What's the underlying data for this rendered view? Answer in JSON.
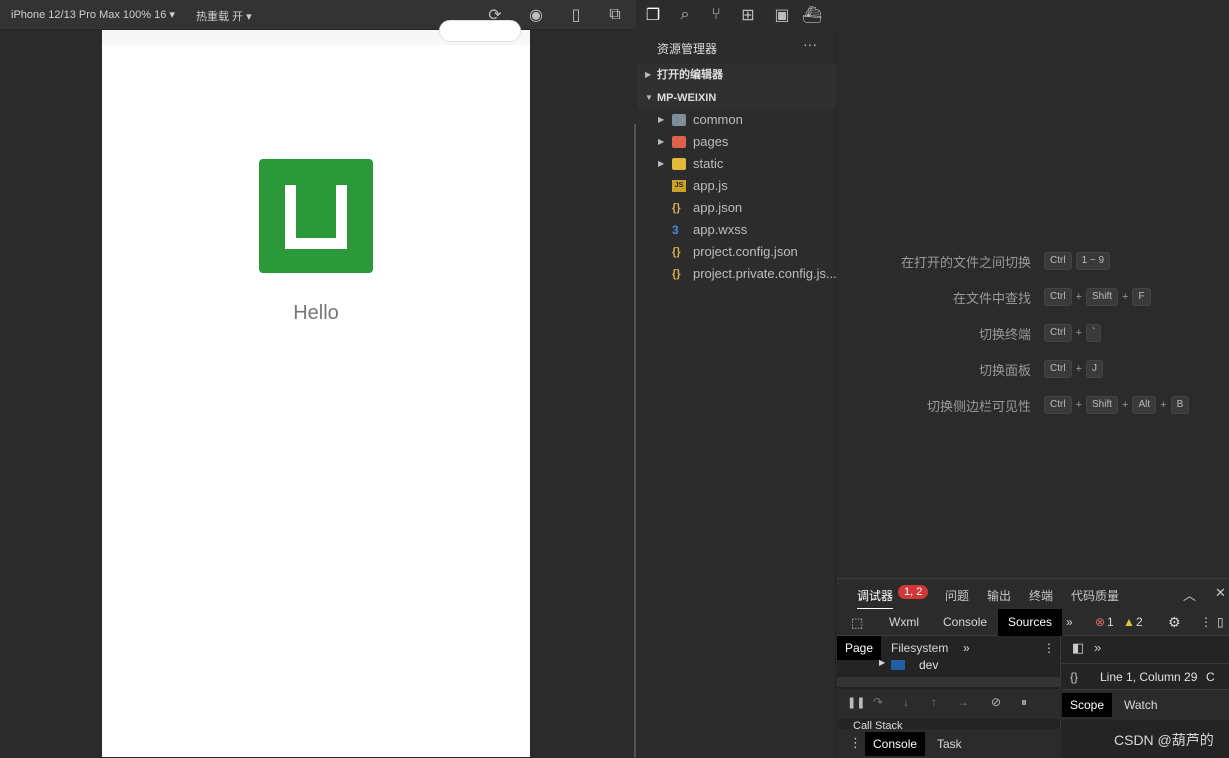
{
  "simulator": {
    "device": "iPhone 12/13 Pro Max 100% 16",
    "hot_reload": "热重载 开",
    "page_text": "Hello",
    "colors": {
      "logo": "#2b9939"
    }
  },
  "explorer": {
    "title": "资源管理器",
    "more": "···",
    "open_editors": "打开的编辑器",
    "project": "MP-WEIXIN",
    "items": [
      {
        "label": "common",
        "type": "folder",
        "icon": "folder-icon"
      },
      {
        "label": "pages",
        "type": "folder",
        "icon": "pages-folder-icon"
      },
      {
        "label": "static",
        "type": "folder",
        "icon": "static-folder-icon"
      },
      {
        "label": "app.js",
        "type": "file",
        "icon": "js-file-icon"
      },
      {
        "label": "app.json",
        "type": "file",
        "icon": "json-file-icon"
      },
      {
        "label": "app.wxss",
        "type": "file",
        "icon": "css-file-icon"
      },
      {
        "label": "project.config.json",
        "type": "file",
        "icon": "json-file-icon"
      },
      {
        "label": "project.private.config.js...",
        "type": "file",
        "icon": "json-file-icon"
      }
    ]
  },
  "shortcuts": [
    {
      "label": "在打开的文件之间切换",
      "keys": [
        "Ctrl",
        "1 ~ 9"
      ]
    },
    {
      "label": "在文件中查找",
      "keys": [
        "Ctrl",
        "Shift",
        "F"
      ]
    },
    {
      "label": "切换终端",
      "keys": [
        "Ctrl",
        "`"
      ]
    },
    {
      "label": "切换面板",
      "keys": [
        "Ctrl",
        "J"
      ]
    },
    {
      "label": "切换侧边栏可见性",
      "keys": [
        "Ctrl",
        "Shift",
        "Alt",
        "B"
      ]
    }
  ],
  "devtools": {
    "panel_tabs": [
      "调试器",
      "问题",
      "输出",
      "终端",
      "代码质量"
    ],
    "debugger_badge": "1, 2",
    "tabs": [
      "Wxml",
      "Console",
      "Sources"
    ],
    "error_count": "1",
    "warning_count": "2",
    "source_tabs": [
      "Page",
      "Filesystem"
    ],
    "tree_item": "dev",
    "position": "Line 1, Column 29",
    "position_suffix": "C",
    "scope_tabs": [
      "Scope",
      "Watch"
    ],
    "call_stack": "Call Stack",
    "drawer_tabs": [
      "Console",
      "Task"
    ]
  },
  "watermark": "CSDN @葫芦的"
}
